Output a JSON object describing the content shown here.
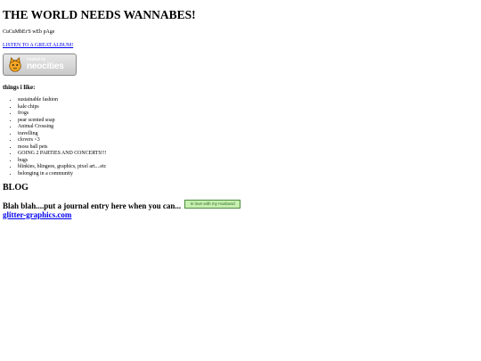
{
  "page": {
    "title": "THE WORLD NEEDS WANNABES!",
    "subtitle": "CuCuMbEr'S wEb pAge",
    "album_link": "LISTEN TO A GREAT ALBUM!"
  },
  "badge": {
    "small_text": "hosted by",
    "brand_text": "neocities",
    "icon": "cat-icon"
  },
  "likes": {
    "heading": "things i like:",
    "items": [
      "sustainable fashion",
      "kale chips",
      "frogs",
      "pear scented soap",
      "Animal Crossing",
      "travelling",
      "clovers <3",
      "moss ball pets",
      "GOING 2 PARTIES AND CONCERTS!!!",
      "bugs",
      "blinkies, blingees, graphics, pixel art....etc",
      "belonging in a community"
    ]
  },
  "blog": {
    "heading": "BLOG",
    "entry_text": "Blah blah....put a journal entry here when you can...",
    "sticker_text": "In love with my Husband",
    "glitter_link": "glitter-graphics.com"
  },
  "colors": {
    "link": "#0000ee",
    "sticker_bg": "#c7efb1",
    "sticker_text": "#2b6a20"
  }
}
